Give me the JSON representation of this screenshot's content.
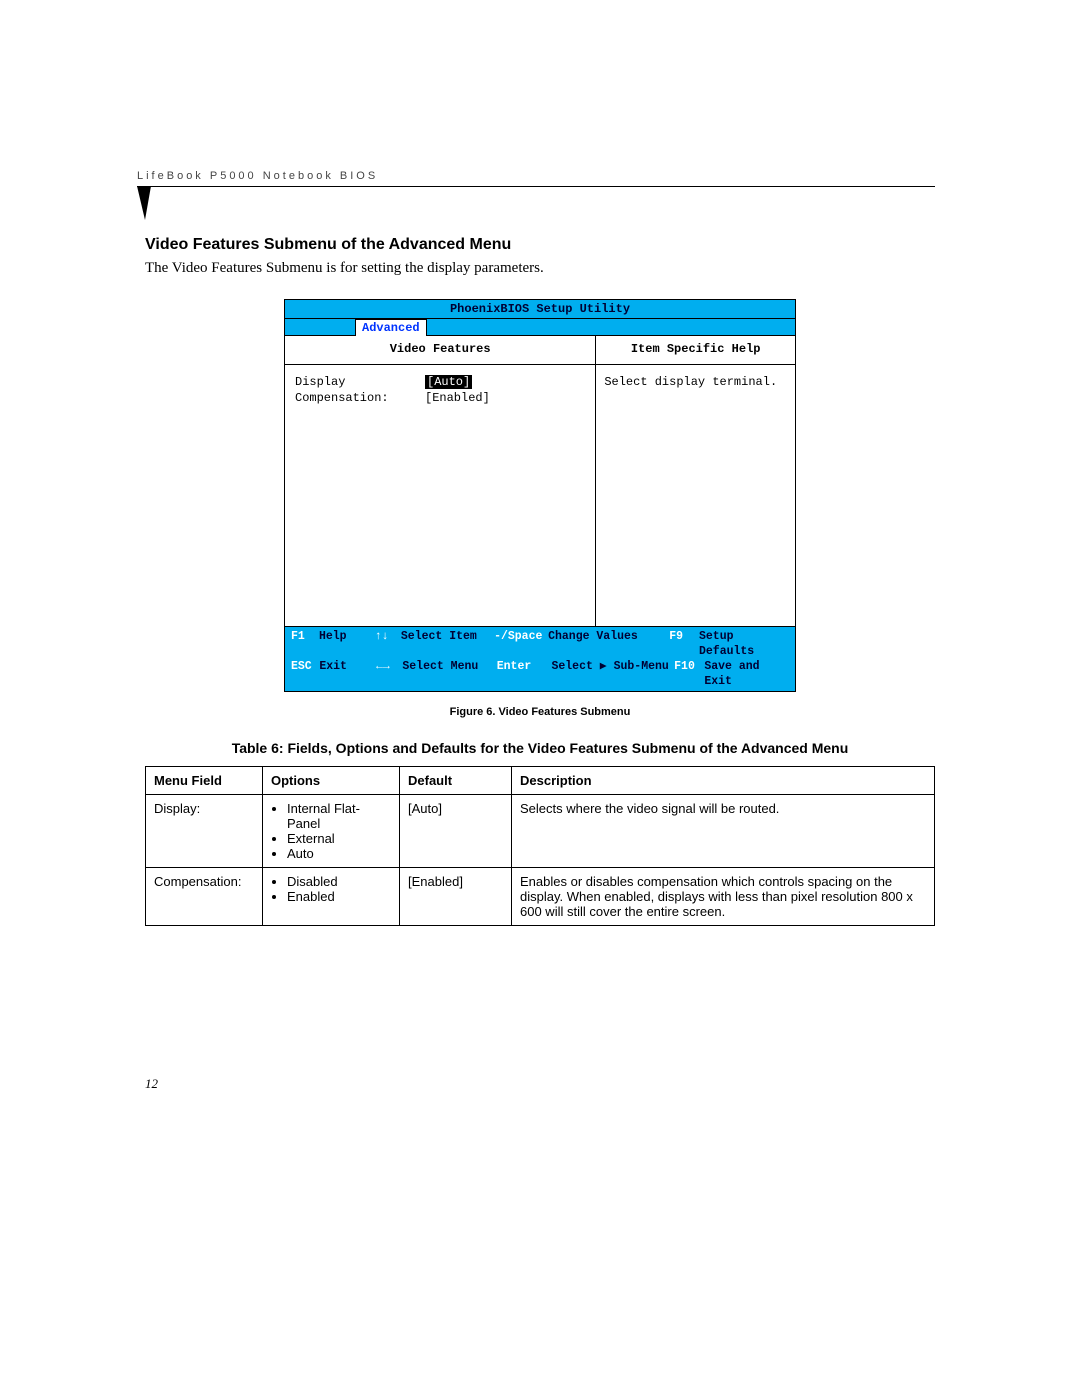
{
  "header": {
    "running": "LifeBook P5000 Notebook BIOS"
  },
  "section": {
    "heading": "Video Features Submenu of the Advanced Menu",
    "intro": "The Video Features Submenu is for setting the display parameters."
  },
  "bios": {
    "title": "PhoenixBIOS Setup Utility",
    "tab": "Advanced",
    "left_heading": "Video Features",
    "right_heading": "Item Specific Help",
    "rows": [
      {
        "label": "Display",
        "value": "[Auto]",
        "selected": true
      },
      {
        "label": "Compensation:",
        "value": "[Enabled]",
        "selected": false
      }
    ],
    "help_text": "Select display terminal.",
    "footer": {
      "r1": {
        "k1": "F1",
        "t1": "Help",
        "k2": "↑↓",
        "t2": "Select Item",
        "k3": "-/Space",
        "t3": "Change Values",
        "k4": "F9",
        "t4": "Setup Defaults"
      },
      "r2": {
        "k1": "ESC",
        "t1": "Exit",
        "k2": "←→",
        "t2": "Select Menu",
        "k3": "Enter",
        "t3": "Select ▶ Sub-Menu",
        "k4": "F10",
        "t4": "Save and Exit"
      }
    }
  },
  "figure_caption": "Figure 6.  Video Features Submenu",
  "table": {
    "caption": "Table 6: Fields, Options and Defaults for the Video Features Submenu of the Advanced Menu",
    "headers": {
      "field": "Menu Field",
      "options": "Options",
      "def": "Default",
      "desc": "Description"
    },
    "rows": [
      {
        "field": "Display:",
        "options": [
          "Internal Flat-Panel",
          "External",
          "Auto"
        ],
        "def": "[Auto]",
        "desc": "Selects where the video signal will be routed."
      },
      {
        "field": "Compensation:",
        "options": [
          "Disabled",
          "Enabled"
        ],
        "def": "[Enabled]",
        "desc": "Enables or disables compensation which controls spacing on the display. When enabled, displays with less than pixel resolution 800 x 600 will still cover the entire screen."
      }
    ]
  },
  "page_number": "12"
}
